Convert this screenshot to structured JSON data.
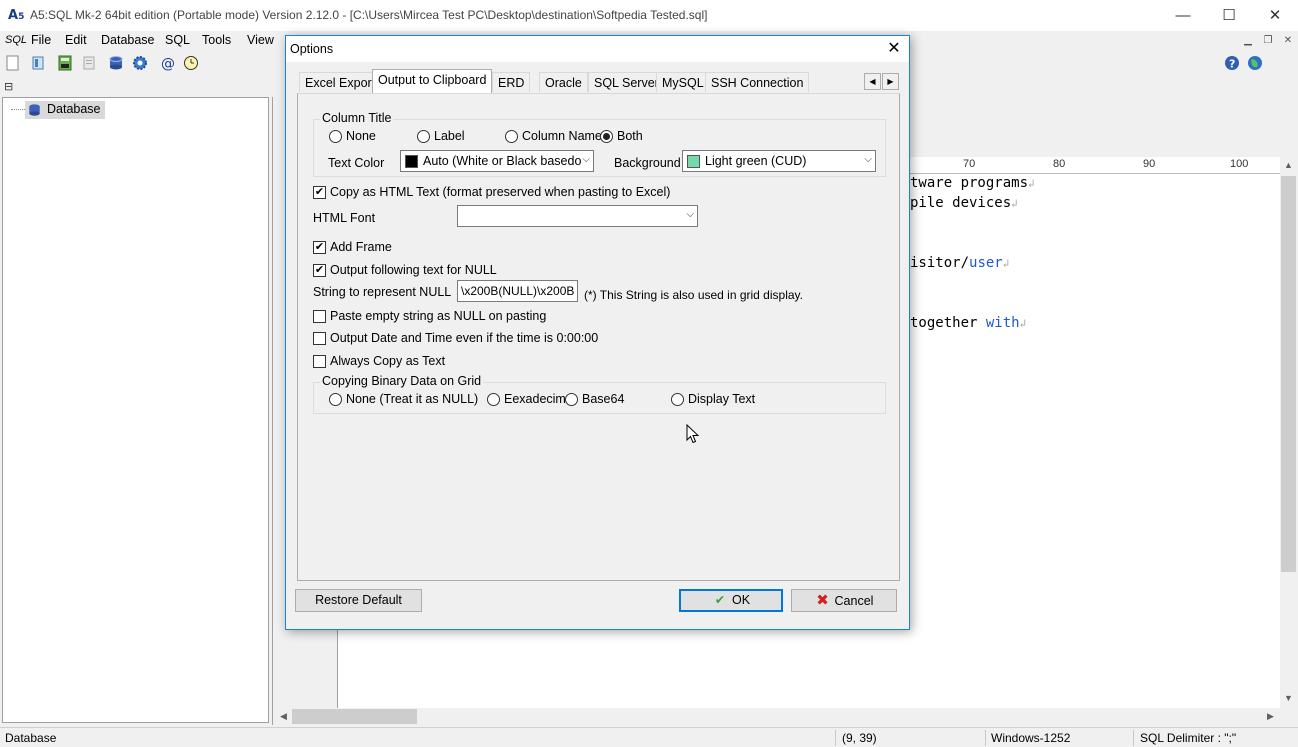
{
  "window": {
    "title": "A5:SQL Mk-2 64bit edition (Portable mode) Version 2.12.0 - [C:\\Users\\Mircea Test PC\\Desktop\\destination\\Softpedia Tested.sql]",
    "minimize": "—",
    "maximize": "☐",
    "close": "✕"
  },
  "menubar": {
    "sql_icon": "SQL",
    "items": [
      "File",
      "Edit",
      "Database",
      "SQL",
      "Tools",
      "View"
    ]
  },
  "tree": {
    "root_label": "Database"
  },
  "editor": {
    "ruler_numbers": [
      "70",
      "80",
      "90",
      "100"
    ],
    "lines": [
      {
        "text": "tware programs",
        "kw": ""
      },
      {
        "text": "pile devices",
        "kw": ""
      },
      {
        "text": "isitor/",
        "kw": "user"
      },
      {
        "text": " together ",
        "kw": "with"
      }
    ],
    "eol_mark": "↲"
  },
  "statusbar": {
    "left": "Database",
    "position": "(9, 39)",
    "encoding": "Windows-1252",
    "delimiter": "SQL Delimiter : \";\""
  },
  "dialog": {
    "title": "Options",
    "close_glyph": "✕",
    "tabs": [
      "Excel Export",
      "Output to Clipboard",
      "ERD",
      "Oracle",
      "SQL Server",
      "MySQL",
      "SSH Connection"
    ],
    "active_tab": "Output to Clipboard",
    "column_title": {
      "group_label": "Column Title",
      "options": [
        "None",
        "Label",
        "Column Name",
        "Both"
      ],
      "selected": "Both",
      "text_color_label": "Text Color",
      "text_color_value": "Auto (White or Black basedo",
      "text_color_swatch": "#000000",
      "background_label": "Background",
      "background_value": "Light green (CUD)",
      "background_swatch": "#77d9a8"
    },
    "copy_as_html": {
      "label": "Copy as HTML Text (format preserved when pasting to Excel)",
      "checked": true
    },
    "html_font": {
      "label": "HTML Font",
      "value": ""
    },
    "add_frame": {
      "label": "Add Frame",
      "checked": true
    },
    "output_null": {
      "label": "Output following text for NULL",
      "checked": true
    },
    "null_string": {
      "label": "String to represent NULL",
      "value": "\\x200B(NULL)\\x200B",
      "note": "(*) This String is also used in grid display."
    },
    "paste_empty": {
      "label": "Paste empty string as NULL on pasting",
      "checked": false
    },
    "output_datetime": {
      "label": "Output Date and Time even if the time is 0:00:00",
      "checked": false
    },
    "always_copy_text": {
      "label": "Always Copy as Text",
      "checked": false
    },
    "binary": {
      "group_label": "Copying Binary Data on Grid",
      "options": [
        "None (Treat it as NULL)",
        "Eexadecima",
        "Base64",
        "Display Text"
      ],
      "selected": ""
    },
    "restore_default": "Restore Default",
    "ok": "OK",
    "cancel": "Cancel",
    "check_mark": "✔"
  }
}
